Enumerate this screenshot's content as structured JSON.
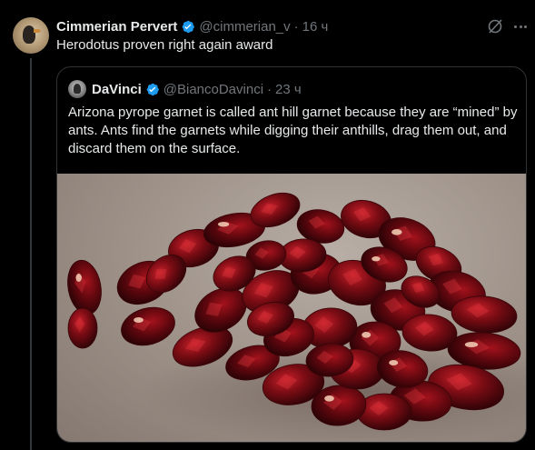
{
  "tweet": {
    "author_name": "Cimmerian Pervert",
    "handle": "@cimmerian_v",
    "separator": "·",
    "time": "16 ч",
    "text": "Herodotus proven right again award"
  },
  "quote": {
    "author_name": "DaVinci",
    "handle": "@BiancoDavinci",
    "separator": "·",
    "time": "23 ч",
    "text": "Arizona pyrope garnet is called ant hill garnet because they are “mined” by ants. Ants find the garnets while digging their anthills, drag them out, and discard them on the surface.",
    "media": "garnet-pile-photo"
  },
  "icons": {
    "verified": "verified-badge-icon",
    "grok": "grok-icon",
    "more": "more-icon"
  },
  "colors": {
    "background": "#000000",
    "text": "#e7e9ea",
    "muted": "#71767b",
    "verified": "#1d9bf0",
    "border": "#2f3336"
  }
}
